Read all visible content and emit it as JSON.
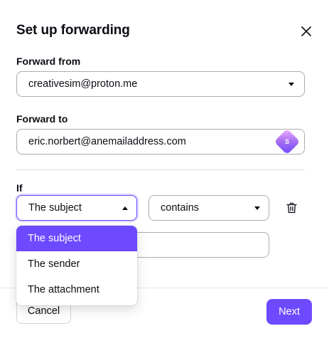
{
  "dialog": {
    "title": "Set up forwarding",
    "close_icon": "close-icon"
  },
  "forward_from": {
    "label": "Forward from",
    "value": "creativesim@proton.me"
  },
  "forward_to": {
    "label": "Forward to",
    "value": "eric.norbert@anemailaddress.com",
    "badge_icon": "simplelogin-icon",
    "badge_letter": "S"
  },
  "condition": {
    "label": "If",
    "field_select": "The subject",
    "operator_select": "contains",
    "value": "",
    "delete_icon": "trash-icon",
    "field_options": [
      "The subject",
      "The sender",
      "The attachment"
    ],
    "selected_option": "The subject"
  },
  "footer": {
    "cancel_label": "Cancel",
    "next_label": "Next"
  },
  "colors": {
    "accent": "#6d4aff",
    "border": "#adabb3",
    "text": "#0c0c14"
  }
}
